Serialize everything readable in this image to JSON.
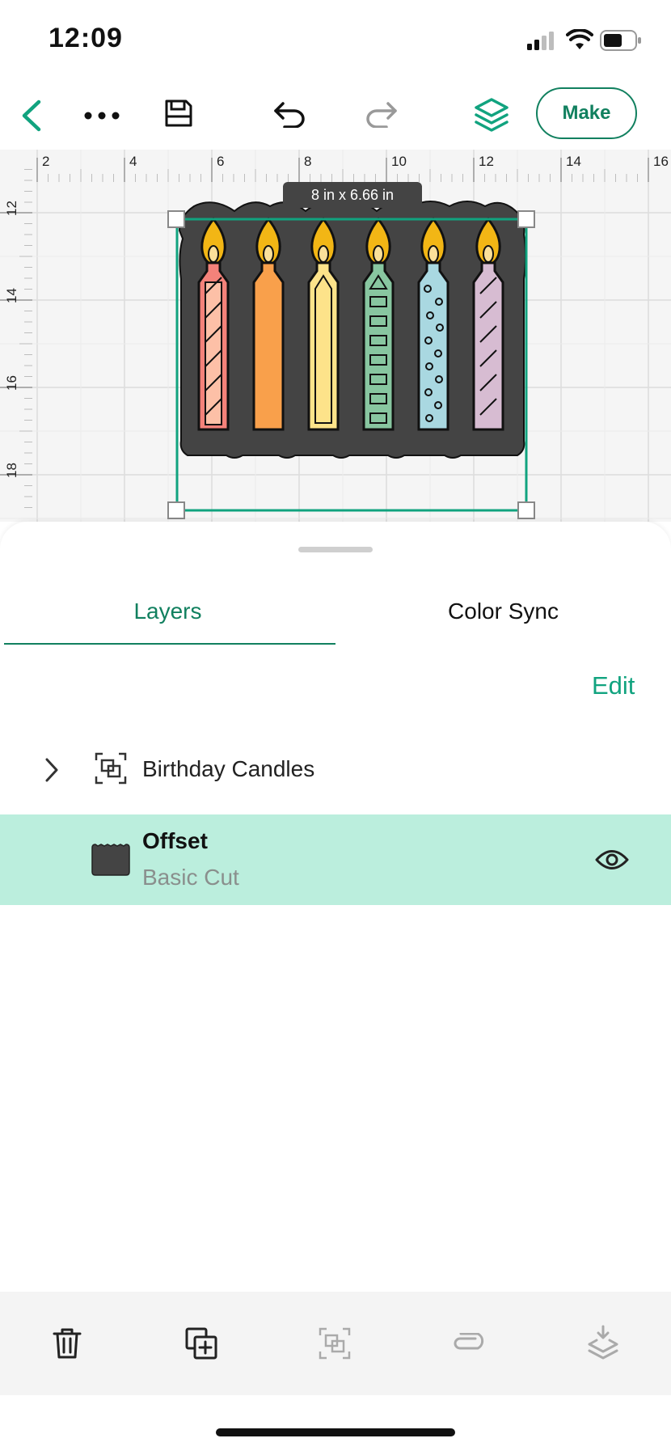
{
  "status_bar": {
    "time": "12:09"
  },
  "toolbar": {
    "make_label": "Make"
  },
  "canvas": {
    "size_badge": "8 in x 6.66 in",
    "ruler_top": [
      "2",
      "4",
      "6",
      "8",
      "10",
      "12",
      "14",
      "16"
    ],
    "ruler_left": [
      "12",
      "14",
      "16",
      "18"
    ],
    "candle_colors": [
      "#f4827a",
      "#f9a04b",
      "#fde38a",
      "#88c6a0",
      "#a9d8e1",
      "#d7bcd2"
    ],
    "accent": "#11a37f"
  },
  "panel": {
    "tabs": [
      {
        "label": "Layers"
      },
      {
        "label": "Color Sync"
      }
    ],
    "edit_label": "Edit",
    "group_label": "Birthday Candles",
    "layer": {
      "title": "Offset",
      "subtitle": "Basic Cut"
    }
  },
  "colors": {
    "brand": "#11805f",
    "selection_row": "#bbeedd"
  }
}
